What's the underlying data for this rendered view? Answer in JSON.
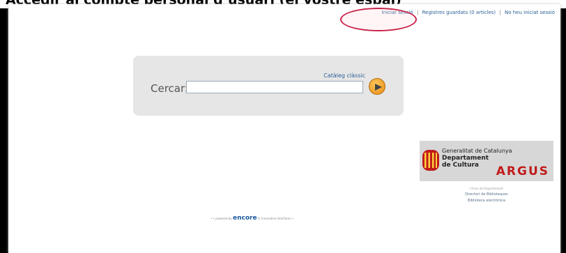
{
  "header_text": "Accedir al compte personal d’usuari (el vostre espai)",
  "top_links": {
    "login": "Iniciar sessió",
    "saved_records": "Registres guardats (0 articles)",
    "not_logged": "No heu iniciat sessió",
    "separator": "|"
  },
  "search": {
    "classic_catalog": "Catàleg clàssic",
    "label": "Cercar:",
    "input_value": ""
  },
  "logo": {
    "line1": "Generalitat de Catalunya",
    "line2": "Departament",
    "line3": "de Cultura",
    "brand": "ARGUS"
  },
  "under_logo": {
    "muted": "l'Arxiu del Departament",
    "link1": "Directori de Biblioteques",
    "link2": "Biblioteca electrònica"
  },
  "footer": {
    "powered_prefix": "• • powered by",
    "brand": "encore",
    "suffix": "© Innovative Interfaces •"
  },
  "colors": {
    "link": "#2b5f98",
    "highlight": "#c9244a",
    "button": "#e48a12",
    "argus": "#c11a1a"
  }
}
